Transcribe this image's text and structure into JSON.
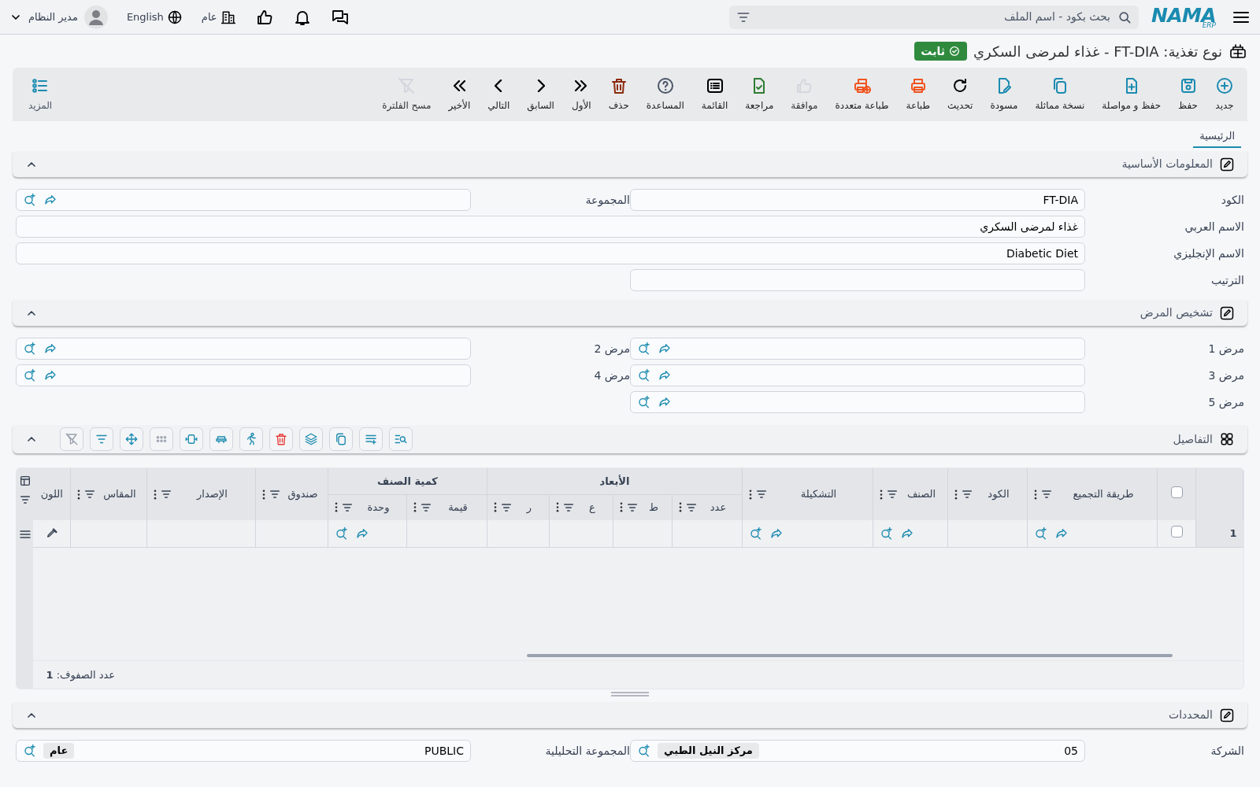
{
  "top_bar": {
    "logo": "NAMA",
    "logo_sub": "ERP",
    "search_placeholder": "بحث بكود - اسم الملف",
    "branch": "عام",
    "language": "English",
    "user": "مدير النظام"
  },
  "title": "نوع تغذية: FT-DIA - غذاء لمرضى السكري",
  "status": {
    "label": "ثابت"
  },
  "toolbar": [
    {
      "label": "جديد",
      "disabled": false
    },
    {
      "label": "حفظ",
      "disabled": false
    },
    {
      "label": "حفظ و مواصلة",
      "disabled": false
    },
    {
      "label": "نسخة مماثلة",
      "disabled": false
    },
    {
      "label": "مسودة",
      "disabled": false
    },
    {
      "label": "تحديث",
      "disabled": false
    },
    {
      "label": "طباعة",
      "disabled": false
    },
    {
      "label": "طباعة متعددة",
      "disabled": false
    },
    {
      "label": "موافقة",
      "disabled": true
    },
    {
      "label": "مراجعة",
      "disabled": false
    },
    {
      "label": "القائمة",
      "disabled": false
    },
    {
      "label": "المساعدة",
      "disabled": false
    },
    {
      "label": "حذف",
      "disabled": false
    },
    {
      "label": "الأول",
      "disabled": false
    },
    {
      "label": "السابق",
      "disabled": false
    },
    {
      "label": "التالي",
      "disabled": false
    },
    {
      "label": "الأخير",
      "disabled": false
    },
    {
      "label": "مسح الفلترة",
      "disabled": true
    }
  ],
  "more_button": {
    "label": "المزيد"
  },
  "tabs": [
    {
      "label": "الرئيسية",
      "selected": true
    }
  ],
  "sections": [
    {
      "kind": "form",
      "title": "المعلومات الأساسية",
      "expanded": true,
      "fields": [
        {
          "label": "الكود",
          "value": "FT-DIA",
          "lookup": false,
          "link": false,
          "wide": false
        },
        {
          "label": "المجموعة",
          "lookup": true,
          "link": true,
          "wide": false
        },
        {
          "label": "الاسم العربي",
          "value": "غذاء لمرضى السكري",
          "lookup": false,
          "link": false,
          "wide": true
        },
        {
          "label": "الاسم الإنجليزي",
          "value": "Diabetic Diet",
          "lookup": false,
          "link": false,
          "wide": true
        },
        {
          "label": "الترتيب",
          "lookup": false,
          "link": false,
          "wide": false
        }
      ]
    },
    {
      "kind": "form",
      "title": "تشخيص المرض",
      "expanded": true,
      "fields": [
        {
          "label": "مرض 1",
          "lookup": true,
          "link": true,
          "wide": false
        },
        {
          "label": "مرض 2",
          "lookup": true,
          "link": true,
          "wide": false
        },
        {
          "label": "مرض 3",
          "lookup": true,
          "link": true,
          "wide": false
        },
        {
          "label": "مرض 4",
          "lookup": true,
          "link": true,
          "wide": false
        },
        {
          "label": "مرض 5",
          "lookup": true,
          "link": true,
          "wide": false
        }
      ]
    },
    {
      "kind": "grid",
      "title": "التفاصيل",
      "expanded": true,
      "columns": [
        {
          "label": "طريقة التجميع",
          "menu": true
        },
        {
          "label": "الكود",
          "menu": true
        },
        {
          "label": "الصنف",
          "menu": true
        },
        {
          "label": "التشكيلة",
          "menu": true
        },
        {
          "label": "الأبعاد",
          "children": [
            {
              "label": "عدد",
              "menu": true
            },
            {
              "label": "ط",
              "menu": true
            },
            {
              "label": "ع",
              "menu": true
            },
            {
              "label": "ر",
              "menu": true
            }
          ]
        },
        {
          "label": "كمية الصنف",
          "children": [
            {
              "label": "قيمة",
              "menu": true
            },
            {
              "label": "وحدة",
              "menu": true
            }
          ]
        },
        {
          "label": "صندوق",
          "menu": true
        },
        {
          "label": "الإصدار",
          "menu": true
        },
        {
          "label": "المقاس",
          "menu": true
        },
        {
          "label": "اللون",
          "menu": false
        }
      ],
      "all_checked": false,
      "rows": [
        {
          "number": "1",
          "checked": false,
          "cells": [
            {
              "kind": "lookup"
            },
            {
              "kind": "empty"
            },
            {
              "kind": "lookup"
            },
            {
              "kind": "lookup"
            },
            {
              "kind": "empty"
            },
            {
              "kind": "empty"
            },
            {
              "kind": "empty"
            },
            {
              "kind": "empty"
            },
            {
              "kind": "empty"
            },
            {
              "kind": "lookup"
            },
            {
              "kind": "empty"
            },
            {
              "kind": "empty"
            },
            {
              "kind": "empty"
            },
            {
              "kind": "color"
            }
          ]
        }
      ],
      "footer": "عدد الصفوف: **1**"
    },
    {
      "kind": "form",
      "title": "المحددات",
      "expanded": true,
      "fields": [
        {
          "label": "الشركة",
          "value": "05",
          "tag": "مركز النيل الطبي",
          "lookup": true,
          "link": false,
          "wide": false
        },
        {
          "label": "المجموعة التحليلية",
          "value": "PUBLIC",
          "tag": "عام",
          "lookup": true,
          "link": false,
          "wide": false
        }
      ]
    }
  ]
}
